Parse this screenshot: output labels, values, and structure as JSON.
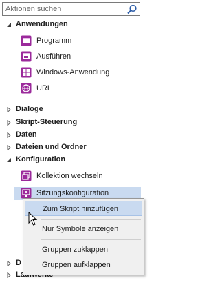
{
  "search": {
    "placeholder": "Aktionen suchen",
    "icon": "search-icon"
  },
  "groups": {
    "anwendungen": {
      "label": "Anwendungen",
      "items": [
        {
          "label": "Programm",
          "icon": "program-window-icon"
        },
        {
          "label": "Ausführen",
          "icon": "run-window-icon"
        },
        {
          "label": "Windows-Anwendung",
          "icon": "windows-app-icon"
        },
        {
          "label": "URL",
          "icon": "url-globe-icon"
        }
      ]
    },
    "dialoge": {
      "label": "Dialoge"
    },
    "skript_steuerung": {
      "label": "Skript-Steuerung"
    },
    "daten": {
      "label": "Daten"
    },
    "dateien_und_ordner": {
      "label": "Dateien und Ordner"
    },
    "konfiguration": {
      "label": "Konfiguration",
      "items": [
        {
          "label": "Kollektion wechseln",
          "icon": "switch-collection-icon"
        },
        {
          "label": "Sitzungskonfiguration",
          "icon": "session-config-icon"
        }
      ]
    },
    "partial_d": {
      "label": "D"
    },
    "laufwerke": {
      "label": "Laufwerke"
    }
  },
  "context_menu": {
    "items": [
      {
        "label": "Zum Skript hinzufügen"
      },
      {
        "label": "Nur Symbole anzeigen"
      },
      {
        "label": "Gruppen zuklappen"
      },
      {
        "label": "Gruppen aufklappen"
      }
    ]
  },
  "colors": {
    "icon_purple": "#9b2a9b",
    "selection": "#c9daf0",
    "menu_bg": "#f0f0f0"
  }
}
